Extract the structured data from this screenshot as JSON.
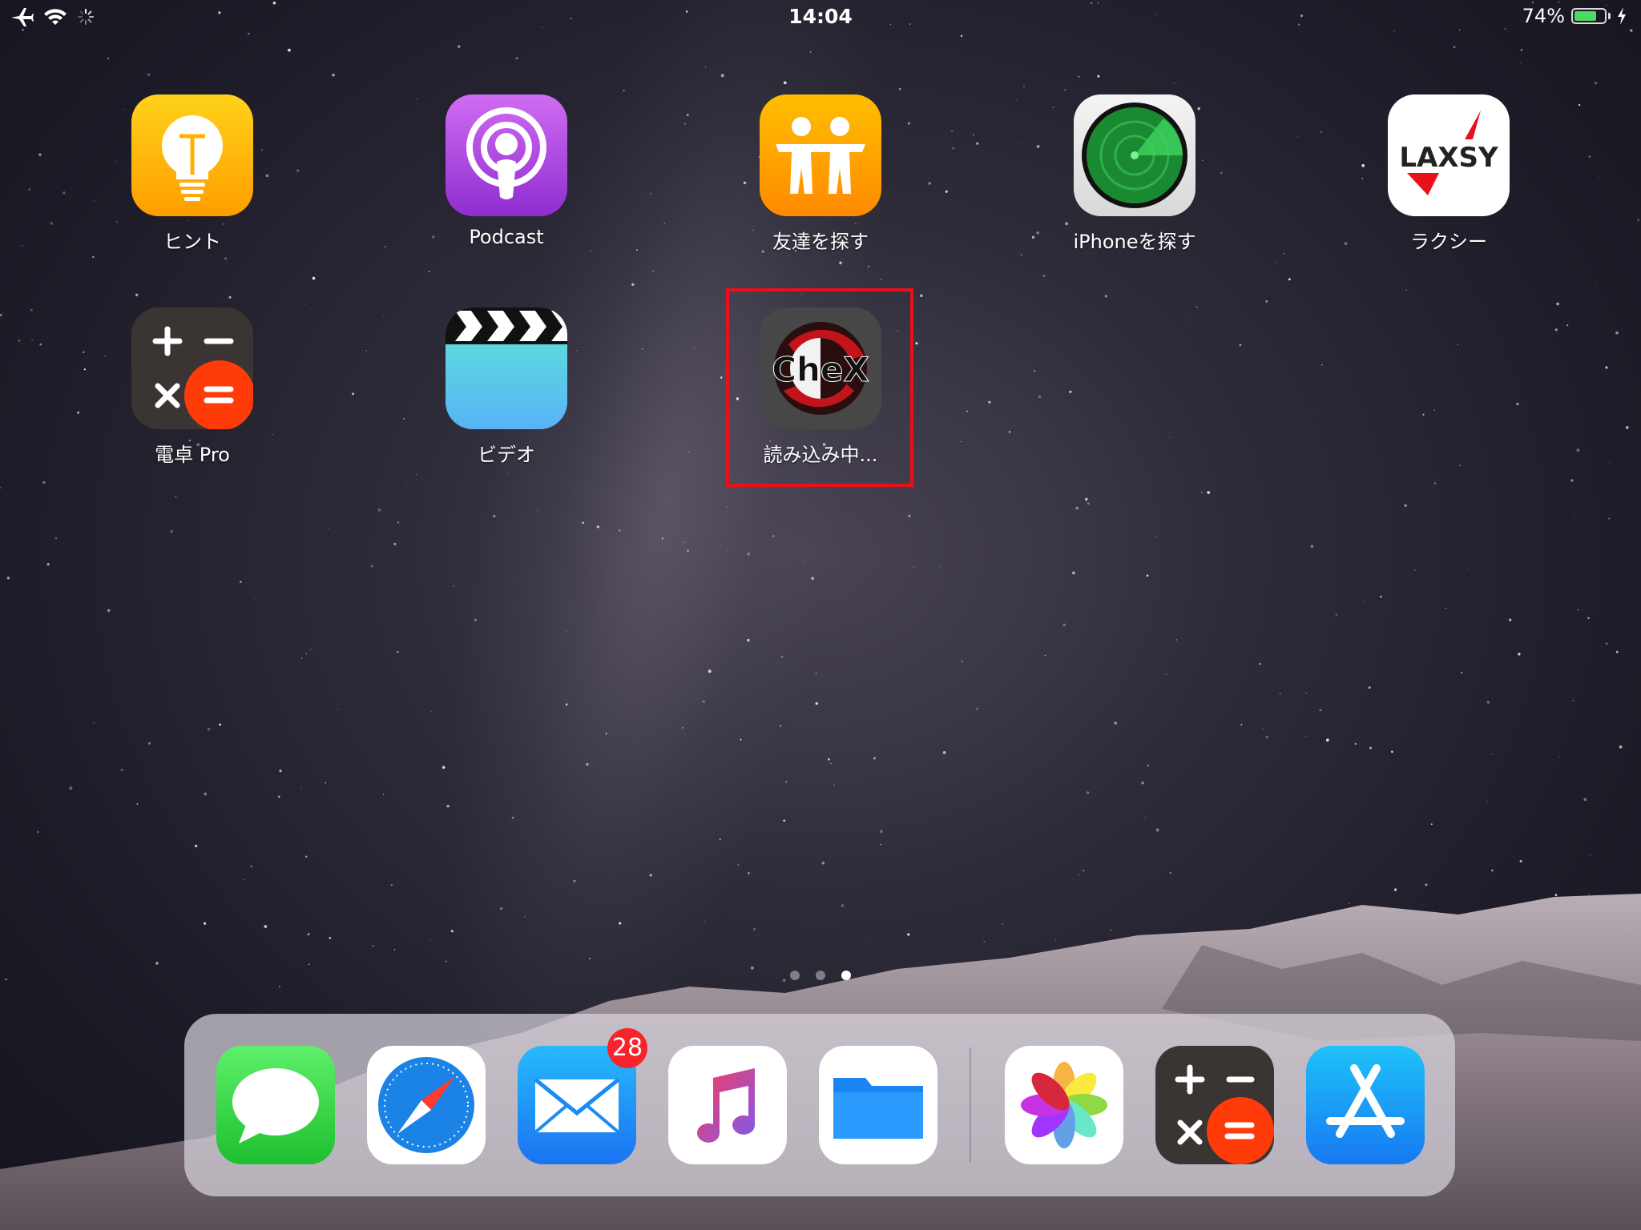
{
  "status_bar": {
    "time": "14:04",
    "battery_percent": "74%",
    "battery_level": 0.74,
    "icons": [
      "airplane-icon",
      "wifi-icon",
      "loading-spinner-icon",
      "charging-bolt-icon"
    ]
  },
  "apps": [
    {
      "label": "ヒント",
      "icon": "lightbulb-icon"
    },
    {
      "label": "Podcast",
      "icon": "podcast-icon"
    },
    {
      "label": "友達を探す",
      "icon": "find-friends-icon"
    },
    {
      "label": "iPhoneを探す",
      "icon": "radar-icon"
    },
    {
      "label": "ラクシー",
      "icon": "laxsy-logo-icon",
      "logo_text": "LAXSY"
    },
    {
      "label": "電卓 Pro",
      "icon": "calculator-icon"
    },
    {
      "label": "ビデオ",
      "icon": "clapperboard-icon"
    },
    {
      "label": "読み込み中...",
      "icon": "chex-logo-icon",
      "logo_text": "CheX",
      "state": "loading",
      "highlighted": true
    }
  ],
  "page_indicator": {
    "pages": 3,
    "current": 3
  },
  "dock": {
    "apps": [
      {
        "name": "messages",
        "icon": "speech-bubble-icon"
      },
      {
        "name": "safari",
        "icon": "compass-icon"
      },
      {
        "name": "mail",
        "icon": "envelope-icon",
        "badge": "28"
      },
      {
        "name": "music",
        "icon": "music-note-icon"
      },
      {
        "name": "files",
        "icon": "folder-icon"
      },
      {
        "name": "photos",
        "icon": "photos-flower-icon"
      },
      {
        "name": "calculator",
        "icon": "calculator-icon"
      },
      {
        "name": "app-store",
        "icon": "app-store-icon"
      }
    ]
  },
  "colors": {
    "selection": "#e8101a",
    "badge": "#f8232c",
    "battery_fill": "#4cd964"
  }
}
